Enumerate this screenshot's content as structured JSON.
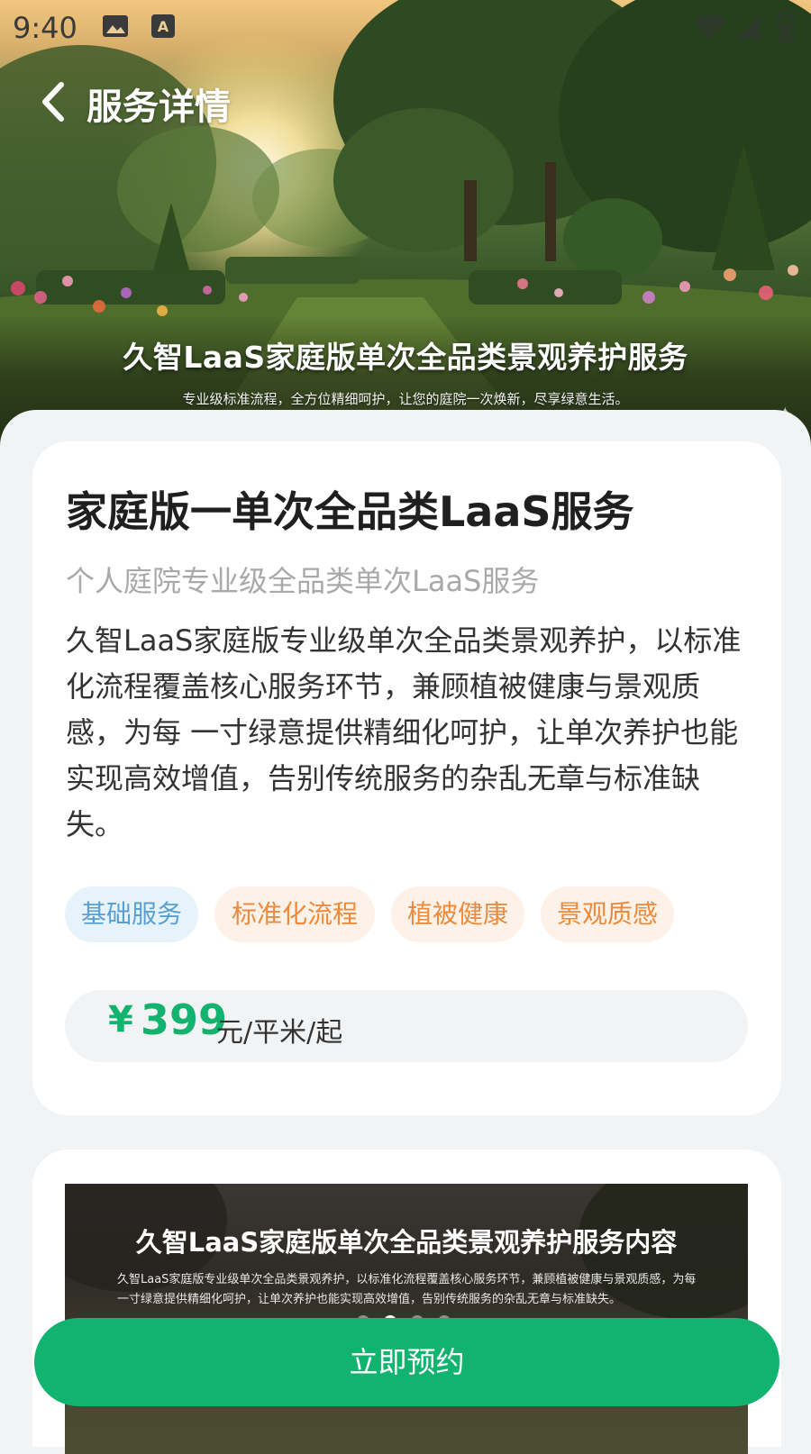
{
  "status_bar": {
    "time": "9:40",
    "icons": [
      "image-icon",
      "text-a-icon",
      "wifi-icon",
      "signal-icon",
      "battery-icon"
    ]
  },
  "header": {
    "title": "服务详情",
    "back_icon": "chevron-left-icon"
  },
  "hero": {
    "title": "久智LaaS家庭版单次全品类景观养护服务",
    "subtitle": "专业级标准流程，全方位精细呵护，让您的庭院一次焕新，尽享绿意生活。"
  },
  "service": {
    "title": "家庭版一单次全品类LaaS服务",
    "subtitle": "个人庭院专业级全品类单次LaaS服务",
    "description": "久智LaaS家庭版专业级单次全品类景观养护，以标准化流程覆盖核心服务环节，兼顾植被健康与景观质感，为每 一寸绿意提供精细化呵护，让单次养护也能实现高效增值，告别传统服务的杂乱无章与标准缺失。",
    "tags": [
      {
        "label": "基础服务",
        "color": "#5a9fd2"
      },
      {
        "label": "标准化流程",
        "color": "#ed8a3c"
      },
      {
        "label": "植被健康",
        "color": "#ed8a3c"
      },
      {
        "label": "景观质感",
        "color": "#ed8a3c"
      }
    ],
    "price": {
      "symbol": "¥",
      "amount": "399",
      "unit": "元/平米/起",
      "color": "#12b36f"
    }
  },
  "detail_banner": {
    "title": "久智LaaS家庭版单次全品类景观养护服务内容",
    "text": "久智LaaS家庭版专业级单次全品类景观养护，以标准化流程覆盖核心服务环节，兼顾植被健康与景观质感，为每一寸绿意提供精细化呵护，让单次养护也能实现高效增值，告别传统服务的杂乱无章与标准缺失。",
    "page_count": 4,
    "active_page": 2
  },
  "actions": {
    "book_label": "立即预约",
    "accent": "#12b36f"
  }
}
